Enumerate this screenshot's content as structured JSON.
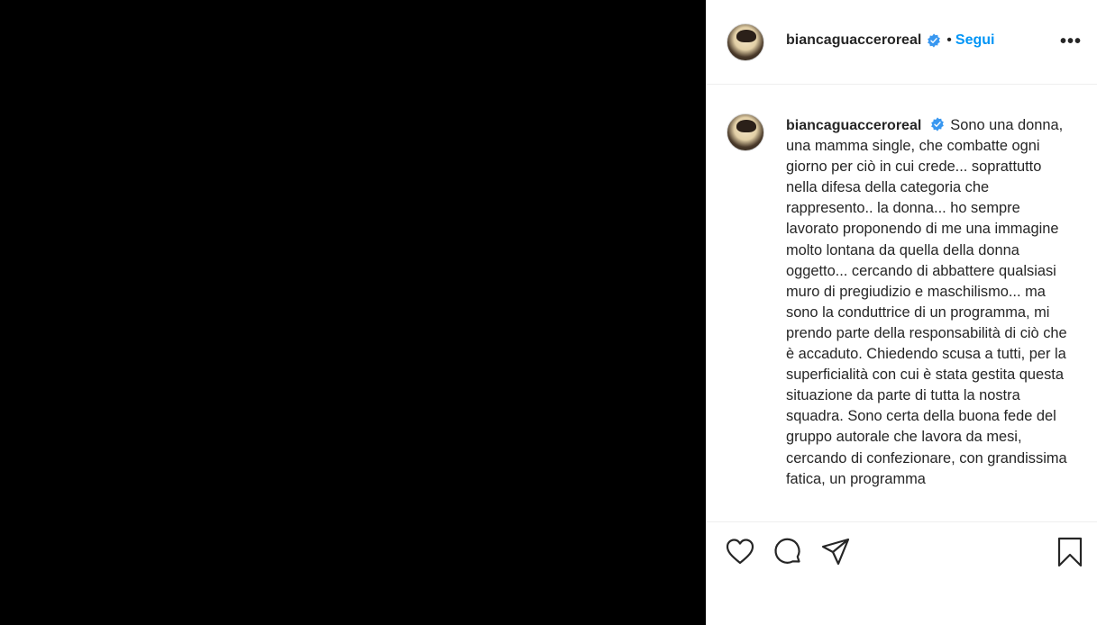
{
  "post": {
    "username": "biancaguaccero​real",
    "follow_label": "Segui",
    "separator": "•",
    "more_label": "•••",
    "caption_text": "Sono una donna, una mamma single, che combatte ogni giorno per ciò in cui crede... soprattutto nella difesa della categoria che rappresento.. la donna... ho sempre lavorato proponendo di me una immagine molto lontana da quella della donna oggetto... cercando di abbattere qualsiasi muro di pregiudizio e maschilismo... ma sono la conduttrice di un programma, mi prendo parte della responsabilità di ciò che è accaduto. Chiedendo scusa a tutti, per la superficialità con cui è stata gestita questa situazione da parte di tutta la nostra squadra. Sono certa della buona fede del gruppo autorale che lavora da mesi, cercando di confezionare, con grandissima fatica, un programma"
  },
  "colors": {
    "media_bg": "#000000",
    "accent": "#0095f6",
    "text": "#262626"
  },
  "icons": [
    "heart-icon",
    "comment-icon",
    "share-icon",
    "bookmark-icon",
    "verified-badge-icon"
  ]
}
